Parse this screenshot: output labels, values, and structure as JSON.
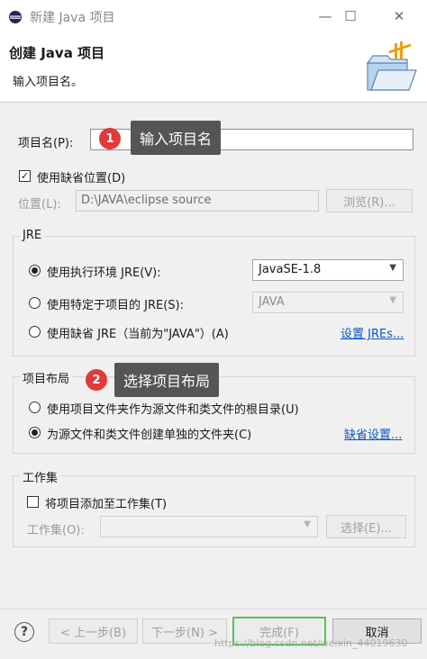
{
  "window": {
    "title": "新建 Java 项目",
    "minimize": "—",
    "maximize": "☐",
    "close": "✕"
  },
  "header": {
    "title": "创建 Java 项目",
    "message": "输入项目名。"
  },
  "project_name": {
    "label": "项目名(P):",
    "value": ""
  },
  "callout1": {
    "number": "1",
    "text": "输入项目名"
  },
  "use_default_location": {
    "label": "使用缺省位置(D)",
    "checked": true
  },
  "location": {
    "label": "位置(L):",
    "value": "D:\\JAVA\\eclipse source",
    "browse": "浏览(R)..."
  },
  "jre": {
    "group_title": "JRE",
    "option1": {
      "label": "使用执行环境 JRE(V):",
      "value": "JavaSE-1.8"
    },
    "option2": {
      "label": "使用特定于项目的 JRE(S):",
      "value": "JAVA"
    },
    "option3": {
      "label": "使用缺省 JRE（当前为\"JAVA\"）(A)",
      "link": "设置 JREs..."
    }
  },
  "layout": {
    "group_title": "项目布局",
    "option1": "使用项目文件夹作为源文件和类文件的根目录(U)",
    "option2": "为源文件和类文件创建单独的文件夹(C)",
    "link": "缺省设置..."
  },
  "callout2": {
    "number": "2",
    "text": "选择项目布局"
  },
  "working_sets": {
    "group_title": "工作集",
    "add_label": "将项目添加至工作集(T)",
    "sets_label": "工作集(O):",
    "select_button": "选择(E)..."
  },
  "footer": {
    "help": "?",
    "back": "< 上一步(B)",
    "next": "下一步(N) >",
    "finish": "完成(F)",
    "cancel": "取消"
  },
  "watermark": "https://blog.csdn.net/weixin_44019630",
  "colors": {
    "accent_link": "#0a58c8",
    "callout_bg": "#555555",
    "callout_num": "#e03a3a",
    "finish_border": "#5fbf5f"
  }
}
